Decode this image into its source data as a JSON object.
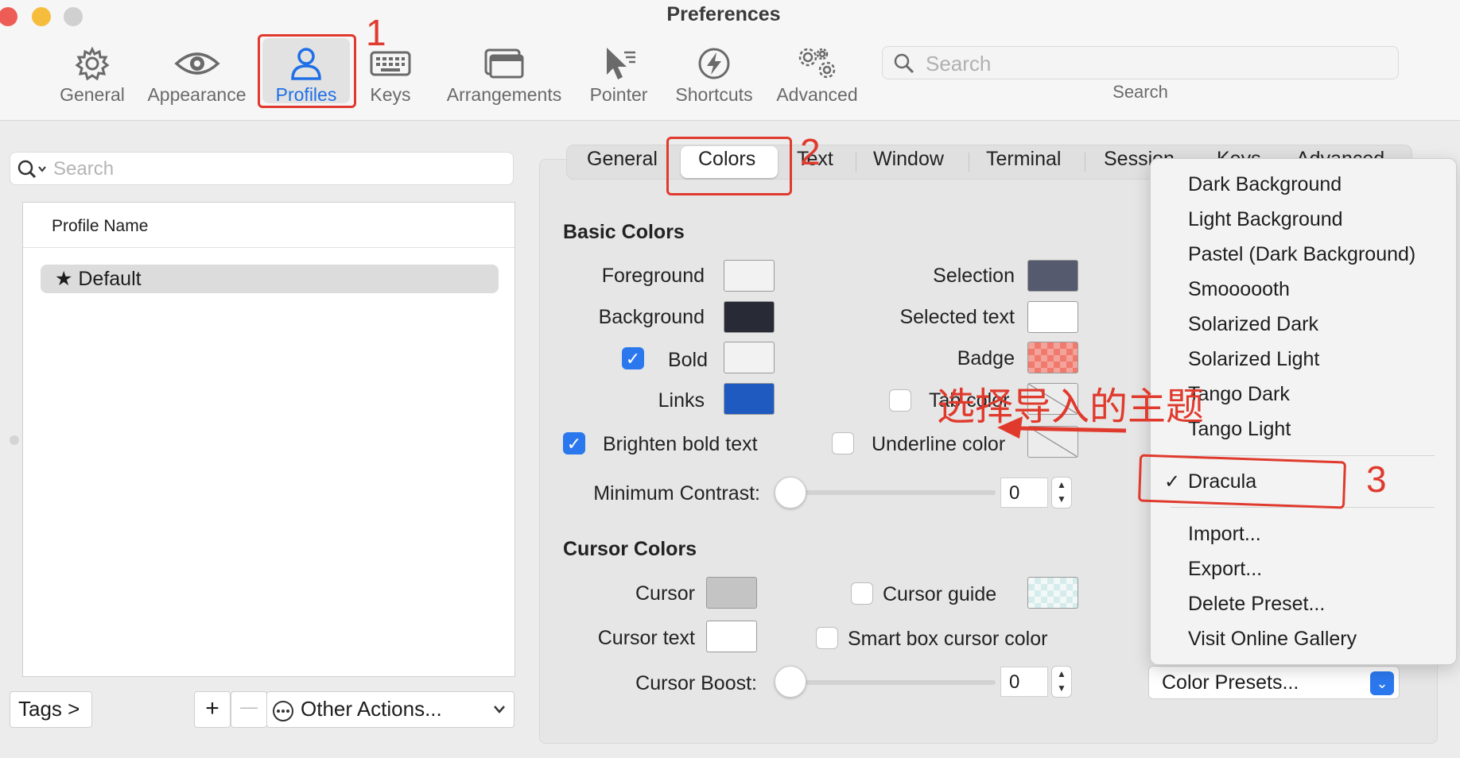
{
  "window": {
    "title": "Preferences"
  },
  "toolbar": {
    "items": [
      {
        "label": "General",
        "icon": "gear-icon"
      },
      {
        "label": "Appearance",
        "icon": "eye-icon"
      },
      {
        "label": "Profiles",
        "icon": "person-icon",
        "active": true
      },
      {
        "label": "Keys",
        "icon": "keyboard-icon"
      },
      {
        "label": "Arrangements",
        "icon": "window-icon"
      },
      {
        "label": "Pointer",
        "icon": "pointer-icon"
      },
      {
        "label": "Shortcuts",
        "icon": "bolt-icon"
      },
      {
        "label": "Advanced",
        "icon": "gears-icon"
      }
    ],
    "search_placeholder": "Search",
    "search_label": "Search"
  },
  "profiles": {
    "search_placeholder": "Search",
    "column_header": "Profile Name",
    "items": [
      {
        "name": "Default",
        "star": "★"
      }
    ],
    "tags_label": "Tags >",
    "add_label": "+",
    "remove_label": "—",
    "other_actions_label": "Other Actions..."
  },
  "tabs": [
    "General",
    "Colors",
    "Text",
    "Window",
    "Terminal",
    "Session",
    "Keys",
    "Advanced"
  ],
  "basic_colors": {
    "title": "Basic Colors",
    "foreground": "Foreground",
    "background": "Background",
    "bold": "Bold",
    "links": "Links",
    "selection": "Selection",
    "selected_text": "Selected text",
    "badge": "Badge",
    "tab_color": "Tab color",
    "brighten_bold": "Brighten bold text",
    "underline_color": "Underline color",
    "min_contrast_label": "Minimum Contrast:",
    "min_contrast_value": "0",
    "swatches": {
      "foreground": "#f2f2f2",
      "background": "#282a36",
      "bold": "#f2f2f2",
      "links": "#1e5abf",
      "selection": "#555a6e",
      "selected_text": "#ffffff",
      "badge": "#f08a7e"
    }
  },
  "cursor_colors": {
    "title": "Cursor Colors",
    "cursor": "Cursor",
    "cursor_text": "Cursor text",
    "cursor_guide": "Cursor guide",
    "smart_box": "Smart box cursor color",
    "boost_label": "Cursor Boost:",
    "boost_value": "0",
    "swatches": {
      "cursor": "#c4c4c4",
      "cursor_text": "#ffffff",
      "cursor_guide": "#e3f0f0"
    }
  },
  "color_presets": {
    "button_label": "Color Presets...",
    "menu_items": [
      "Dark Background",
      "Light Background",
      "Pastel (Dark Background)",
      "Smoooooth",
      "Solarized Dark",
      "Solarized Light",
      "Tango Dark",
      "Tango Light"
    ],
    "selected": "Dracula",
    "checkmark": "✓",
    "actions": [
      "Import...",
      "Export...",
      "Delete Preset...",
      "Visit Online Gallery"
    ]
  },
  "annotations": {
    "step1": "1",
    "step2": "2",
    "step3": "3",
    "note": "选择导入的主题"
  },
  "colors": {
    "accent": "#2b78ee",
    "annotation_red": "#e03a2d"
  }
}
